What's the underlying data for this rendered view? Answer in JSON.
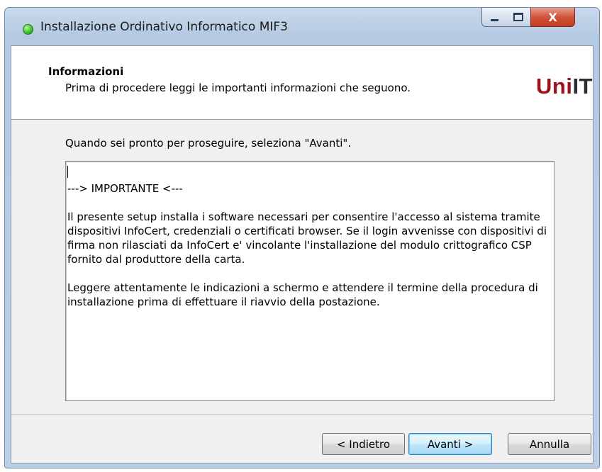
{
  "window": {
    "title": "Installazione Ordinativo Informatico MIF3",
    "controls": {
      "minimize": "minimize-icon",
      "maximize": "maximize-icon",
      "close_label": "X"
    }
  },
  "header": {
    "title": "Informazioni",
    "subtitle": "Prima di procedere leggi le importanti informazioni che seguono.",
    "logo_part1": "Uni",
    "logo_part2": "IT",
    "logo_colors": {
      "uni": "#9e1220",
      "it": "#2e2e2e"
    }
  },
  "instruction": "Quando sei pronto per proseguire, seleziona \"Avanti\".",
  "info_text": {
    "heading": "---> IMPORTANTE <---",
    "paragraph1": "Il presente setup installa i software necessari per consentire l'accesso al sistema tramite dispositivi InfoCert, credenziali o certificati browser. Se il login avvenisse con dispositivi di firma non rilasciati da InfoCert e' vincolante l'installazione del modulo crittografico CSP fornito dal produttore della carta.",
    "paragraph2": "Leggere attentamente le indicazioni a schermo e attendere il termine della procedura di installazione prima di effettuare il riavvio della postazione."
  },
  "buttons": {
    "back": "< Indietro",
    "next": "Avanti >",
    "cancel": "Annulla"
  }
}
